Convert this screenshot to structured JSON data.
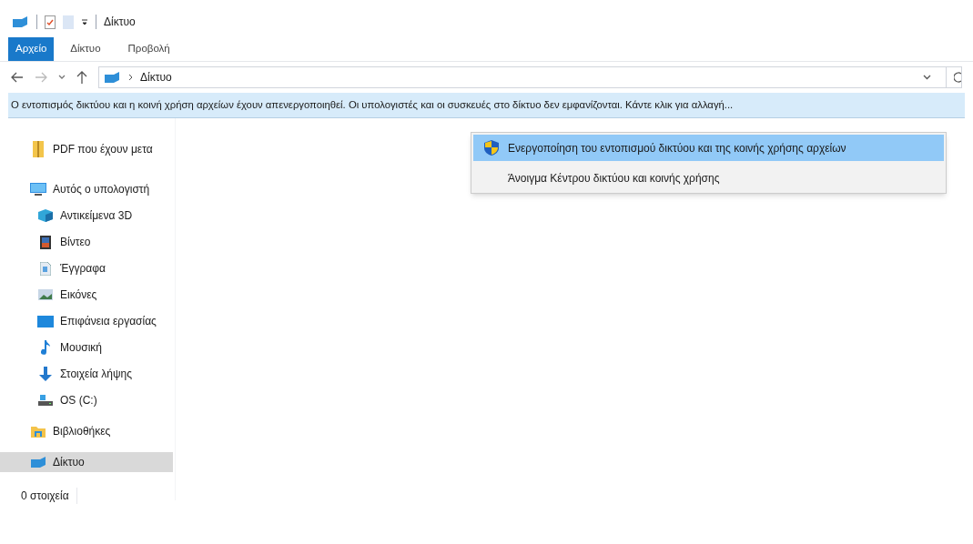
{
  "window": {
    "title": "Δίκτυο"
  },
  "ribbon_tabs": [
    {
      "label": "Αρχείο",
      "selected": true
    },
    {
      "label": "Δίκτυο",
      "selected": false
    },
    {
      "label": "Προβολή",
      "selected": false
    }
  ],
  "address_bar": {
    "path": "Δίκτυο"
  },
  "info_bar": {
    "text": "Ο εντοπισμός δικτύου και η κοινή χρήση αρχείων έχουν απενεργοποιηθεί. Οι υπολογιστές και οι συσκευές στο δίκτυο δεν εμφανίζονται. Κάντε κλικ για αλλαγή..."
  },
  "context_menu": [
    {
      "label": "Ενεργοποίηση του εντοπισμού δικτύου και της κοινής χρήσης αρχείων",
      "selected": true
    },
    {
      "label": "Άνοιγμα Κέντρου δικτύου και κοινής χρήσης",
      "selected": false
    }
  ],
  "sidebar": {
    "items": [
      {
        "label": "PDF που έχουν μετα",
        "selected": false
      },
      {
        "label": "Αυτός ο υπολογιστή",
        "selected": false,
        "children": [
          {
            "label": "Αντικείμενα 3D",
            "selected": false
          },
          {
            "label": "Βίντεο",
            "selected": false
          },
          {
            "label": "Έγγραφα",
            "selected": false
          },
          {
            "label": "Εικόνες",
            "selected": false
          },
          {
            "label": "Επιφάνεια εργασίας",
            "selected": false
          },
          {
            "label": "Μουσική",
            "selected": false
          },
          {
            "label": "Στοιχεία λήψης",
            "selected": false
          },
          {
            "label": "OS (C:)",
            "selected": false
          }
        ]
      },
      {
        "label": "Βιβλιοθήκες",
        "selected": false
      },
      {
        "label": "Δίκτυο",
        "selected": true
      }
    ]
  },
  "status_bar": {
    "text": "0 στοιχεία"
  }
}
